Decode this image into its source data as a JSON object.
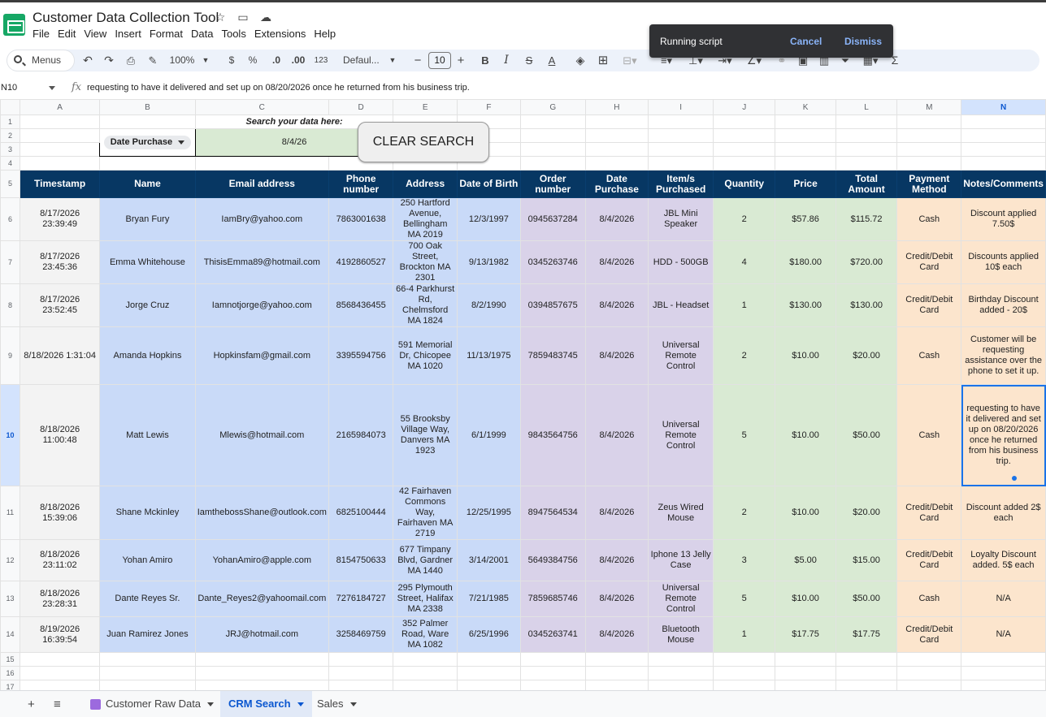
{
  "app": {
    "title": "Customer Data Collection Tool",
    "menu": [
      "File",
      "Edit",
      "View",
      "Insert",
      "Format",
      "Data",
      "Tools",
      "Extensions",
      "Help"
    ]
  },
  "toolbar": {
    "menus_label": "Menus",
    "zoom": "100%",
    "currency": "$",
    "percent": "%",
    "dec_decrease": ".0",
    "dec_increase": ".00",
    "number_format": "123",
    "font": "Defaul...",
    "font_size": "10",
    "minus": "−",
    "plus": "+",
    "bold": "B",
    "italic": "I",
    "strike": "S",
    "text_color": "A",
    "sigma": "Σ"
  },
  "toast": {
    "message": "Running script",
    "cancel": "Cancel",
    "dismiss": "Dismiss"
  },
  "formula_bar": {
    "cell_ref": "N10",
    "fx": "fx",
    "content": "requesting to have it delivered and set up on 08/20/2026 once he returned from his business trip."
  },
  "grid": {
    "columns": [
      "A",
      "B",
      "C",
      "D",
      "E",
      "F",
      "G",
      "H",
      "I",
      "J",
      "K",
      "L",
      "M",
      "N"
    ],
    "selected_column": "N",
    "row_numbers": [
      "1",
      "2",
      "3",
      "4",
      "5",
      "6",
      "7",
      "8",
      "9",
      "10",
      "11",
      "12",
      "13",
      "14",
      "15",
      "16",
      "17",
      "18"
    ],
    "selected_row": "10",
    "search_label": "Search your data here:",
    "search_field": "Date Purchase",
    "search_value": "8/4/26",
    "clear_button": "CLEAR SEARCH",
    "headers": [
      "Timestamp",
      "Name",
      "Email address",
      "Phone number",
      "Address",
      "Date of Birth",
      "Order number",
      "Date Purchase",
      "Item/s Purchased",
      "Quantity",
      "Price",
      "Total Amount",
      "Payment Method",
      "Notes/Comments"
    ],
    "rows": [
      [
        "8/17/2026 23:39:49",
        "Bryan Fury",
        "IamBry@yahoo.com",
        "7863001638",
        "250 Hartford Avenue, Bellingham MA 2019",
        "12/3/1997",
        "0945637284",
        "8/4/2026",
        "JBL Mini Speaker",
        "2",
        "$57.86",
        "$115.72",
        "Cash",
        "Discount applied 7.50$"
      ],
      [
        "8/17/2026 23:45:36",
        "Emma Whitehouse",
        "ThisisEmma89@hotmail.com",
        "4192860527",
        "700 Oak Street, Brockton MA 2301",
        "9/13/1982",
        "0345263746",
        "8/4/2026",
        "HDD - 500GB",
        "4",
        "$180.00",
        "$720.00",
        "Credit/Debit Card",
        "Discounts applied 10$ each"
      ],
      [
        "8/17/2026 23:52:45",
        "Jorge Cruz",
        "Iamnotjorge@yahoo.com",
        "8568436455",
        "66-4 Parkhurst Rd, Chelmsford MA 1824",
        "8/2/1990",
        "0394857675",
        "8/4/2026",
        "JBL - Headset",
        "1",
        "$130.00",
        "$130.00",
        "Credit/Debit Card",
        "Birthday Discount added - 20$"
      ],
      [
        "8/18/2026 1:31:04",
        "Amanda Hopkins",
        "Hopkinsfam@gmail.com",
        "3395594756",
        "591 Memorial Dr, Chicopee MA 1020",
        "11/13/1975",
        "7859483745",
        "8/4/2026",
        "Universal Remote Control",
        "2",
        "$10.00",
        "$20.00",
        "Cash",
        "Customer will be requesting assistance over the phone to set it up."
      ],
      [
        "8/18/2026 11:00:48",
        "Matt Lewis",
        "Mlewis@hotmail.com",
        "2165984073",
        "55 Brooksby Village Way, Danvers MA 1923",
        "6/1/1999",
        "9843564756",
        "8/4/2026",
        "Universal Remote Control",
        "5",
        "$10.00",
        "$50.00",
        "Cash",
        "requesting to have it delivered and set up on 08/20/2026 once he returned from his business trip."
      ],
      [
        "8/18/2026 15:39:06",
        "Shane Mckinley",
        "IamthebossShane@outlook.com",
        "6825100444",
        "42 Fairhaven Commons Way, Fairhaven MA 2719",
        "12/25/1995",
        "8947564534",
        "8/4/2026",
        "Zeus Wired Mouse",
        "2",
        "$10.00",
        "$20.00",
        "Credit/Debit Card",
        "Discount added 2$ each"
      ],
      [
        "8/18/2026 23:11:02",
        "Yohan Amiro",
        "YohanAmiro@apple.com",
        "8154750633",
        "677 Timpany Blvd, Gardner MA 1440",
        "3/14/2001",
        "5649384756",
        "8/4/2026",
        "Iphone 13 Jelly Case",
        "3",
        "$5.00",
        "$15.00",
        "Credit/Debit Card",
        "Loyalty Discount added. 5$ each"
      ],
      [
        "8/18/2026 23:28:31",
        "Dante Reyes Sr.",
        "Dante_Reyes2@yahoomail.com",
        "7276184727",
        "295 Plymouth Street, Halifax MA 2338",
        "7/21/1985",
        "7859685746",
        "8/4/2026",
        "Universal Remote Control",
        "5",
        "$10.00",
        "$50.00",
        "Cash",
        "N/A"
      ],
      [
        "8/19/2026 16:39:54",
        "Juan Ramirez Jones",
        "JRJ@hotmail.com",
        "3258469759",
        "352 Palmer Road, Ware MA 1082",
        "6/25/1996",
        "0345263741",
        "8/4/2026",
        "Bluetooth Mouse",
        "1",
        "$17.75",
        "$17.75",
        "Credit/Debit Card",
        "N/A"
      ]
    ]
  },
  "sheet_tabs": [
    {
      "label": "Customer Raw Data",
      "active": false
    },
    {
      "label": "CRM Search",
      "active": true
    },
    {
      "label": "Sales",
      "active": false
    }
  ],
  "colors": {
    "header_bg": "#073763",
    "blue_band": "#c9daf8",
    "purple_band": "#d9d2e9",
    "green_band": "#d9ead3",
    "orange_band": "#fce5cd",
    "accent": "#1a73e8"
  }
}
